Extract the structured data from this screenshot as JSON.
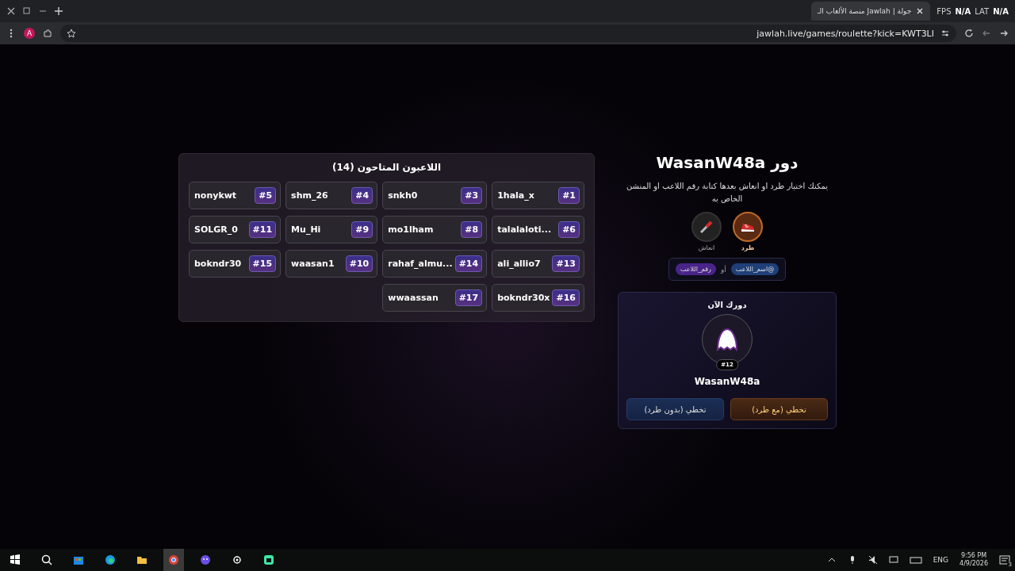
{
  "browser": {
    "tab": {
      "title": "جولة | Jawlah منصة الألعاب الـ"
    },
    "overlay": [
      "FPS",
      "N/A",
      "LAT",
      "N/A"
    ],
    "profile_initial": "A",
    "url": "jawlah.live/games/roulette?kick=KWT3LI"
  },
  "players": {
    "title": "اللاعبون المتاحون (14)",
    "items": [
      {
        "name": "nonykwt",
        "number": "#5"
      },
      {
        "name": "shm_26",
        "number": "#4"
      },
      {
        "name": "snkh0",
        "number": "#3"
      },
      {
        "name": "1hala_x",
        "number": "#1"
      },
      {
        "name": "SOLGR_0",
        "number": "#11"
      },
      {
        "name": "Mu_Hi",
        "number": "#9"
      },
      {
        "name": "mo1lham",
        "number": "#8"
      },
      {
        "name": "talalaloti...",
        "number": "#6"
      },
      {
        "name": "bokndr30",
        "number": "#15"
      },
      {
        "name": "waasan1",
        "number": "#10"
      },
      {
        "name": "rahaf_almu...",
        "number": "#14"
      },
      {
        "name": "ali_allio7",
        "number": "#13"
      },
      {
        "name": "wwaassan",
        "number": "#17"
      },
      {
        "name": "bokndr30x",
        "number": "#16"
      }
    ]
  },
  "turn": {
    "title": "دور WasanW48a",
    "description": "يمكنك اختيار طرد او انعاش بعدها كتابة رقم اللاعب او المنشن الخاص به",
    "actions": [
      {
        "kind": "kick",
        "label": "طرد",
        "selected": true
      },
      {
        "kind": "revive",
        "label": "انعاش",
        "selected": false
      }
    ],
    "hints": [
      {
        "kind": "chip",
        "text": "@اسم_اللاعب",
        "color": "#1f3f78"
      },
      {
        "kind": "separator",
        "text": "أو"
      },
      {
        "kind": "chip",
        "text": "رقم_اللاعب",
        "color": "#4a2488"
      }
    ]
  },
  "current": {
    "heading": "دورك الآن",
    "badge": "#12",
    "name": "WasanW48a",
    "buttons": [
      {
        "kind": "kick",
        "label": "تخطي (مع طرد)"
      },
      {
        "kind": "plain",
        "label": "تخطي (بدون طرد)"
      }
    ]
  },
  "taskbar": {
    "language": "ENG",
    "time": "9:56 PM",
    "date": "4/9/2026",
    "notification_count": "3"
  }
}
